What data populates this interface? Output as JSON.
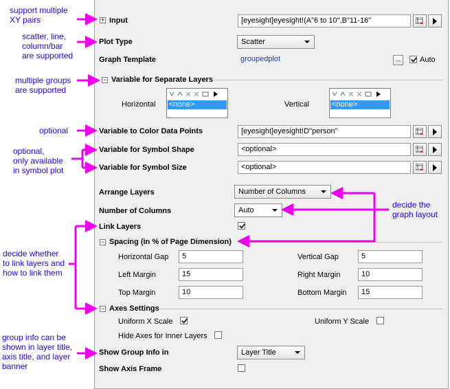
{
  "annotations": {
    "xy_pairs": [
      "support multiple",
      "XY pairs"
    ],
    "plot_types": [
      "scatter, line,",
      "column/bar",
      "are supported"
    ],
    "groups": [
      "multiple groups",
      "are supported"
    ],
    "optional": "optional",
    "optional_symbol": [
      "optional,",
      "only available",
      "in symbol plot"
    ],
    "layout": [
      "decide the",
      "graph layout"
    ],
    "link": [
      "decide whether",
      "to link layers and",
      "how to link them"
    ],
    "group_info": [
      "group info can be",
      "shown in layer title,",
      "axis title, and layer",
      "banner"
    ]
  },
  "input": {
    "label": "Input",
    "value": "[eyesight]eyesight!(A\"6 to 10\",B\"11-16\""
  },
  "plot_type": {
    "label": "Plot Type",
    "value": "Scatter"
  },
  "graph_template": {
    "label": "Graph Template",
    "value": "groupedplot",
    "browse": "...",
    "auto_label": "Auto",
    "auto_checked": true
  },
  "separate_layers": {
    "header": "Variable for Separate Layers",
    "horizontal_label": "Horizontal",
    "vertical_label": "Vertical",
    "horizontal_value": "<none>",
    "vertical_value": "<none>"
  },
  "color_points": {
    "label": "Variable to Color Data Points",
    "value": "[eyesight]eyesight!D\"person\""
  },
  "symbol_shape": {
    "label": "Variable for Symbol Shape",
    "value": "<optional>"
  },
  "symbol_size": {
    "label": "Variable for Symbol Size",
    "value": "<optional>"
  },
  "arrange_layers": {
    "label": "Arrange Layers",
    "value": "Number of Columns"
  },
  "num_columns": {
    "label": "Number of Columns",
    "value": "Auto"
  },
  "link_layers": {
    "label": "Link Layers",
    "checked": true
  },
  "spacing": {
    "header": "Spacing (in % of Page Dimension)",
    "horizontal_gap": {
      "label": "Horizontal Gap",
      "value": "5"
    },
    "vertical_gap": {
      "label": "Vertical Gap",
      "value": "5"
    },
    "left_margin": {
      "label": "Left Margin",
      "value": "15"
    },
    "right_margin": {
      "label": "Right Margin",
      "value": "10"
    },
    "top_margin": {
      "label": "Top Margin",
      "value": "10"
    },
    "bottom_margin": {
      "label": "Bottom Margin",
      "value": "15"
    }
  },
  "axes": {
    "header": "Axes Settings",
    "uniform_x": {
      "label": "Uniform X Scale",
      "checked": true
    },
    "uniform_y": {
      "label": "Uniform Y Scale",
      "checked": false
    },
    "hide_inner": {
      "label": "Hide Axes for Inner Layers",
      "checked": false
    }
  },
  "group_info": {
    "label": "Show Group Info in",
    "value": "Layer Title"
  },
  "axis_frame": {
    "label": "Show Axis Frame",
    "checked": false
  },
  "colors": {
    "annotation": "#2a00e0",
    "arrow": "#ee00ee",
    "selection": "#3399ff",
    "link": "#1a3da8"
  },
  "icons": [
    "expand-icon",
    "collapse-icon",
    "column-picker-icon",
    "play-arrow-icon",
    "checkmark-icon"
  ]
}
